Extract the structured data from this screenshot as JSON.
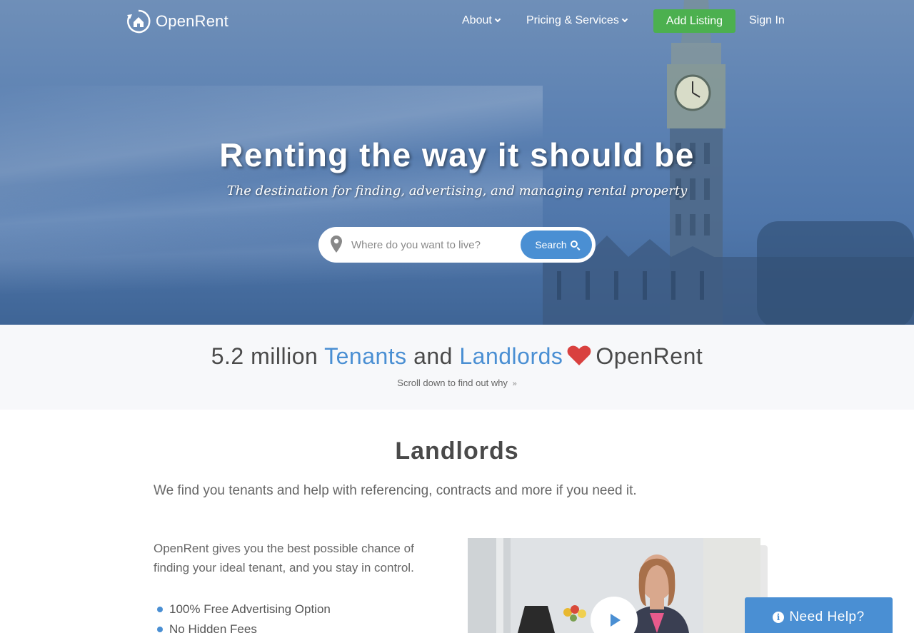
{
  "nav": {
    "logo_text": "OpenRent",
    "about_label": "About",
    "pricing_label": "Pricing & Services",
    "add_listing_label": "Add Listing",
    "sign_in_label": "Sign In"
  },
  "hero": {
    "title": "Renting the way it should be",
    "subtitle": "The destination for finding, advertising, and managing rental property",
    "search_placeholder": "Where do you want to live?",
    "search_button": "Search"
  },
  "stats": {
    "count": "5.2 million",
    "tenants": "Tenants",
    "and": "and",
    "landlords": "Landlords",
    "brand": "OpenRent",
    "scroll_hint": "Scroll down to find out why"
  },
  "landlords": {
    "title": "Landlords",
    "lead": "We find you tenants and help with referencing, contracts and more if you need it.",
    "body": "OpenRent gives you the best possible chance of finding your ideal tenant, and you stay in control.",
    "bullets": [
      "100% Free Advertising Option",
      "No Hidden Fees"
    ]
  },
  "help": {
    "label": "Need Help?"
  },
  "colors": {
    "accent": "#4a8fd3",
    "green": "#4cb04f",
    "heart": "#d9413f"
  },
  "icons": [
    "logo-house-icon",
    "pin-icon",
    "search-icon",
    "heart-icon",
    "play-icon",
    "info-icon",
    "chevron-down-icon"
  ]
}
